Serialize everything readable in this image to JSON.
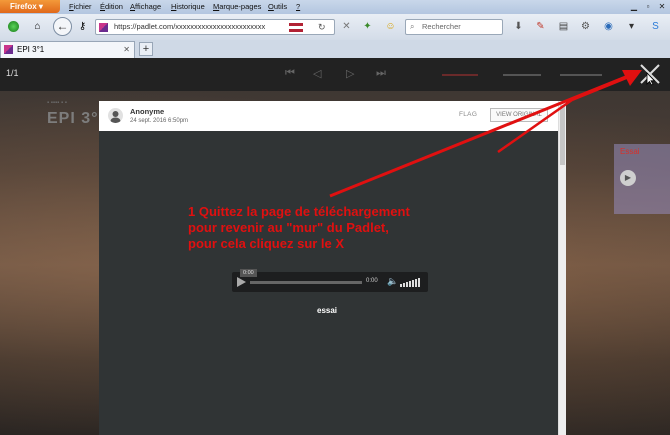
{
  "browser": {
    "firefox_button": "Firefox",
    "menu": [
      {
        "first": "F",
        "rest": "ichier"
      },
      {
        "first": "É",
        "rest": "dition"
      },
      {
        "first": "A",
        "rest": "ffichage"
      },
      {
        "first": "H",
        "rest": "istorique"
      },
      {
        "first": "M",
        "rest": "arque-pages"
      },
      {
        "first": "O",
        "rest": "utils"
      },
      {
        "first": "?",
        "rest": ""
      }
    ],
    "url": "https://padlet.com/xxxxxxxxxxxxxxxxxxxxxxxx",
    "search_placeholder": "Rechercher",
    "tab_title": "EPI 3°1",
    "new_tab": "+"
  },
  "viewer": {
    "counter": "1/1",
    "wall_title": "EPI 3°1"
  },
  "post": {
    "author": "Anonyme",
    "date": "24 sept. 2016 6:50pm",
    "flag_label": "FLAG",
    "view_original_label": "VIEW ORIGINAL",
    "player_tooltip": "0:00",
    "player_time": "0:00",
    "caption": "essai"
  },
  "sidecard": {
    "title": "Essai"
  },
  "annotation": {
    "text": "1 Quittez la page de téléchargement\npour revenir au \"mur\" du Padlet,\npour cela cliquez sur le X",
    "color": "#e01010"
  }
}
